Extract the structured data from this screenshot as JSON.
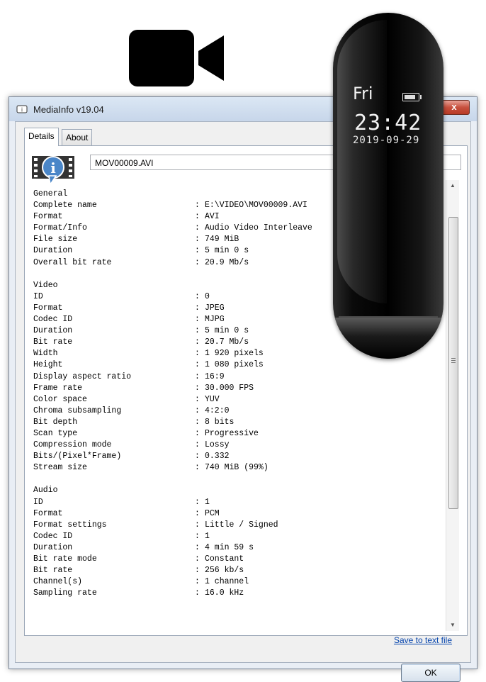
{
  "window": {
    "title": "MediaInfo v19.04",
    "close_label": "x"
  },
  "tabs": [
    {
      "label": "Details",
      "active": true
    },
    {
      "label": "About",
      "active": false
    }
  ],
  "file_field": {
    "value": "MOV00009.AVI"
  },
  "report": {
    "general": {
      "heading": "General",
      "rows": [
        {
          "k": "Complete name",
          "v": "E:\\VIDEO\\MOV00009.AVI"
        },
        {
          "k": "Format",
          "v": "AVI"
        },
        {
          "k": "Format/Info",
          "v": "Audio Video Interleave"
        },
        {
          "k": "File size",
          "v": "749 MiB"
        },
        {
          "k": "Duration",
          "v": "5 min 0 s"
        },
        {
          "k": "Overall bit rate",
          "v": "20.9 Mb/s"
        }
      ]
    },
    "video": {
      "heading": "Video",
      "rows": [
        {
          "k": "ID",
          "v": "0"
        },
        {
          "k": "Format",
          "v": "JPEG"
        },
        {
          "k": "Codec ID",
          "v": "MJPG"
        },
        {
          "k": "Duration",
          "v": "5 min 0 s"
        },
        {
          "k": "Bit rate",
          "v": "20.7 Mb/s"
        },
        {
          "k": "Width",
          "v": "1 920 pixels"
        },
        {
          "k": "Height",
          "v": "1 080 pixels"
        },
        {
          "k": "Display aspect ratio",
          "v": "16:9"
        },
        {
          "k": "Frame rate",
          "v": "30.000 FPS"
        },
        {
          "k": "Color space",
          "v": "YUV"
        },
        {
          "k": "Chroma subsampling",
          "v": "4:2:0"
        },
        {
          "k": "Bit depth",
          "v": "8 bits"
        },
        {
          "k": "Scan type",
          "v": "Progressive"
        },
        {
          "k": "Compression mode",
          "v": "Lossy"
        },
        {
          "k": "Bits/(Pixel*Frame)",
          "v": "0.332"
        },
        {
          "k": "Stream size",
          "v": "740 MiB (99%)"
        }
      ]
    },
    "audio": {
      "heading": "Audio",
      "rows": [
        {
          "k": "ID",
          "v": "1"
        },
        {
          "k": "Format",
          "v": "PCM"
        },
        {
          "k": "Format settings",
          "v": "Little / Signed"
        },
        {
          "k": "Codec ID",
          "v": "1"
        },
        {
          "k": "Duration",
          "v": "4 min 59 s"
        },
        {
          "k": "Bit rate mode",
          "v": "Constant"
        },
        {
          "k": "Bit rate",
          "v": "256 kb/s"
        },
        {
          "k": "Channel(s)",
          "v": "1 channel"
        },
        {
          "k": "Sampling rate",
          "v": "16.0 kHz"
        }
      ]
    }
  },
  "save_link": "Save to text file",
  "ok_label": "OK",
  "device": {
    "day": "Fri",
    "time": "23:42",
    "date": "2019-09-29",
    "battery_level": 0.85
  },
  "icons": [
    "video-camera-icon",
    "mediainfo-app-icon",
    "mediainfo-logo-icon",
    "battery-icon"
  ],
  "colors": {
    "link": "#0645ad",
    "close_button": "#c7503e",
    "device_body": "#000000"
  }
}
